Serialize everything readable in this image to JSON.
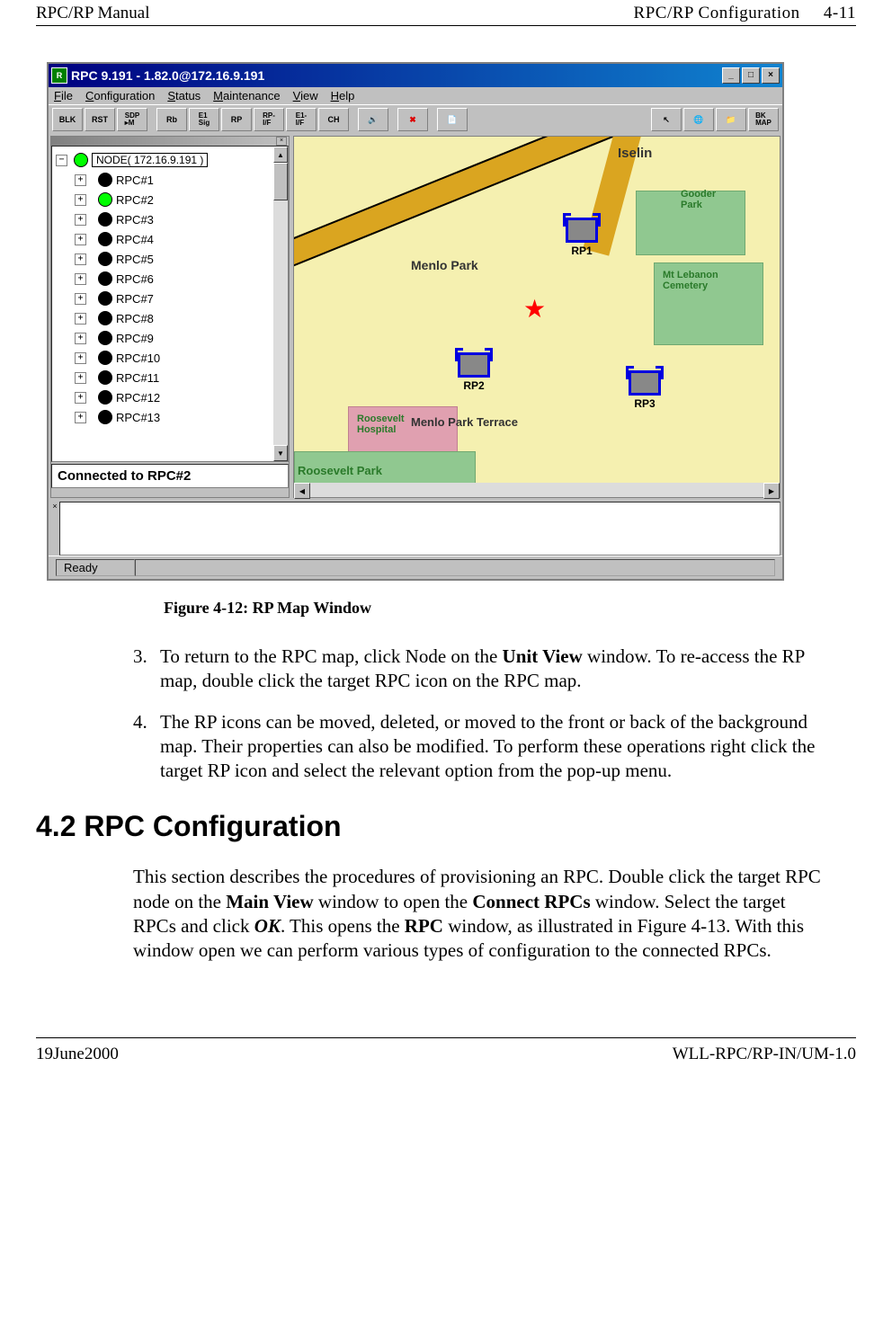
{
  "header": {
    "left": "RPC/RP Manual",
    "right_section": "RPC/RP Configuration",
    "right_page": "4-11"
  },
  "window": {
    "title": "RPC 9.191 - 1.82.0@172.16.9.191",
    "menus": {
      "file": "File",
      "configuration": "Configuration",
      "status": "Status",
      "maintenance": "Maintenance",
      "view": "View",
      "help": "Help"
    },
    "toolbar": {
      "blk": "BLK",
      "rst": "RST",
      "sdp": "SDP",
      "rb": "Rb",
      "e1sig": "E1\nSig",
      "rp": "RP",
      "rpif": "RP\nI/F",
      "e1if": "E1\nI/F",
      "ch": "CH",
      "bkmap": "BK\nMAP"
    },
    "tree": {
      "root": "NODE( 172.16.9.191 )",
      "items": [
        {
          "label": "RPC#1",
          "color": "black"
        },
        {
          "label": "RPC#2",
          "color": "green"
        },
        {
          "label": "RPC#3",
          "color": "black"
        },
        {
          "label": "RPC#4",
          "color": "black"
        },
        {
          "label": "RPC#5",
          "color": "black"
        },
        {
          "label": "RPC#6",
          "color": "black"
        },
        {
          "label": "RPC#7",
          "color": "black"
        },
        {
          "label": "RPC#8",
          "color": "black"
        },
        {
          "label": "RPC#9",
          "color": "black"
        },
        {
          "label": "RPC#10",
          "color": "black"
        },
        {
          "label": "RPC#11",
          "color": "black"
        },
        {
          "label": "RPC#12",
          "color": "black"
        },
        {
          "label": "RPC#13",
          "color": "black"
        }
      ],
      "status": "Connected to RPC#2"
    },
    "map": {
      "labels": {
        "iselin": "Iselin",
        "menlo_park": "Menlo Park",
        "menlo_park_terrace": "Menlo Park Terrace",
        "roosevelt_hospital": "Roosevelt\nHospital",
        "roosevelt_park": "Roosevelt Park",
        "mt_lebanon": "Mt Lebanon\nCemetery",
        "gooder_park": "Gooder\nPark"
      },
      "markers": {
        "rp1": "RP1",
        "rp2": "RP2",
        "rp3": "RP3"
      }
    },
    "statusbar": "Ready"
  },
  "figure_caption": "Figure 4-12:  RP Map Window",
  "steps": {
    "s3": "To return to the RPC map, click Node on the Unit View window.  To re-access the RP map, double click the target RPC icon on the RPC map.",
    "s4": "The RP icons can be moved, deleted, or moved to the front or back of the background map.  Their properties can also be modified.  To perform these operations right click the target RP icon and select the relevant option from the pop-up menu."
  },
  "section_heading": "4.2 RPC Configuration",
  "section_para": "This section describes the procedures of provisioning an RPC.  Double click the target RPC node on the Main View window to open the Connect RPCs window.  Select the target RPCs and click OK.  This opens the RPC window, as illustrated in Figure 4-13.  With this window open we can perform various types of configuration to the connected RPCs.",
  "footer": {
    "left": "19June2000",
    "right": "WLL-RPC/RP-IN/UM-1.0"
  }
}
